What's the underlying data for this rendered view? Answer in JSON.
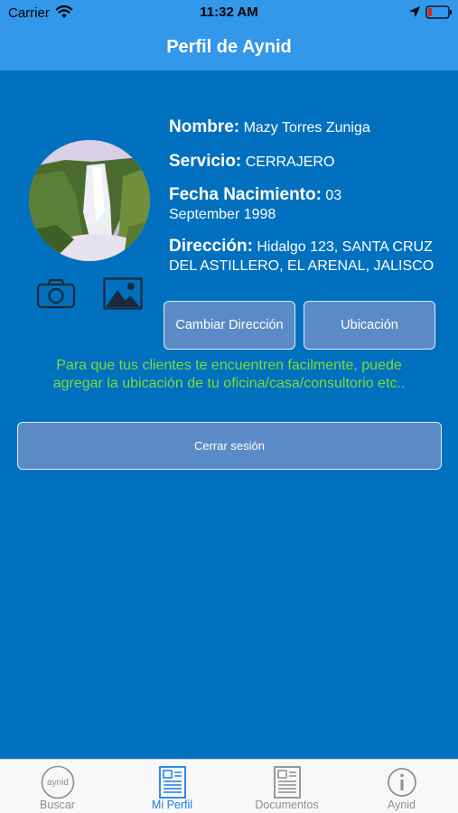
{
  "status_bar": {
    "carrier": "Carrier",
    "time": "11:32 AM"
  },
  "nav": {
    "title": "Perfil de Aynid"
  },
  "profile": {
    "name_label": "Nombre:",
    "name_value": "Mazy Torres Zuniga",
    "service_label": "Servicio:",
    "service_value": "CERRAJERO",
    "birth_label": "Fecha Nacimiento:",
    "birth_value": "03 September 1998",
    "address_label": "Dirección:",
    "address_value": "Hidalgo 123, SANTA CRUZ DEL ASTILLERO, EL ARENAL, JALISCO"
  },
  "buttons": {
    "change_address": "Cambiar Dirección",
    "location": "Ubicación",
    "logout": "Cerrar sesión"
  },
  "hint": {
    "line1": "Para que tus clientes te encuentren facilmente, puede",
    "line2": "agregar la ubicación de tu oficina/casa/consultorio etc.."
  },
  "tabs": [
    {
      "label": "Buscar",
      "icon": "aynid-logo-icon",
      "logo_text": "aynid"
    },
    {
      "label": "Mi Perfil",
      "icon": "profile-document-icon",
      "active": true
    },
    {
      "label": "Documentos",
      "icon": "documents-icon"
    },
    {
      "label": "Aynid",
      "icon": "info-icon"
    }
  ],
  "colors": {
    "background": "#0070bf",
    "nav": "#3397ea",
    "hint": "#7ddb3a",
    "tab_active": "#1d7fe8",
    "tab_inactive": "#8e8e93"
  }
}
